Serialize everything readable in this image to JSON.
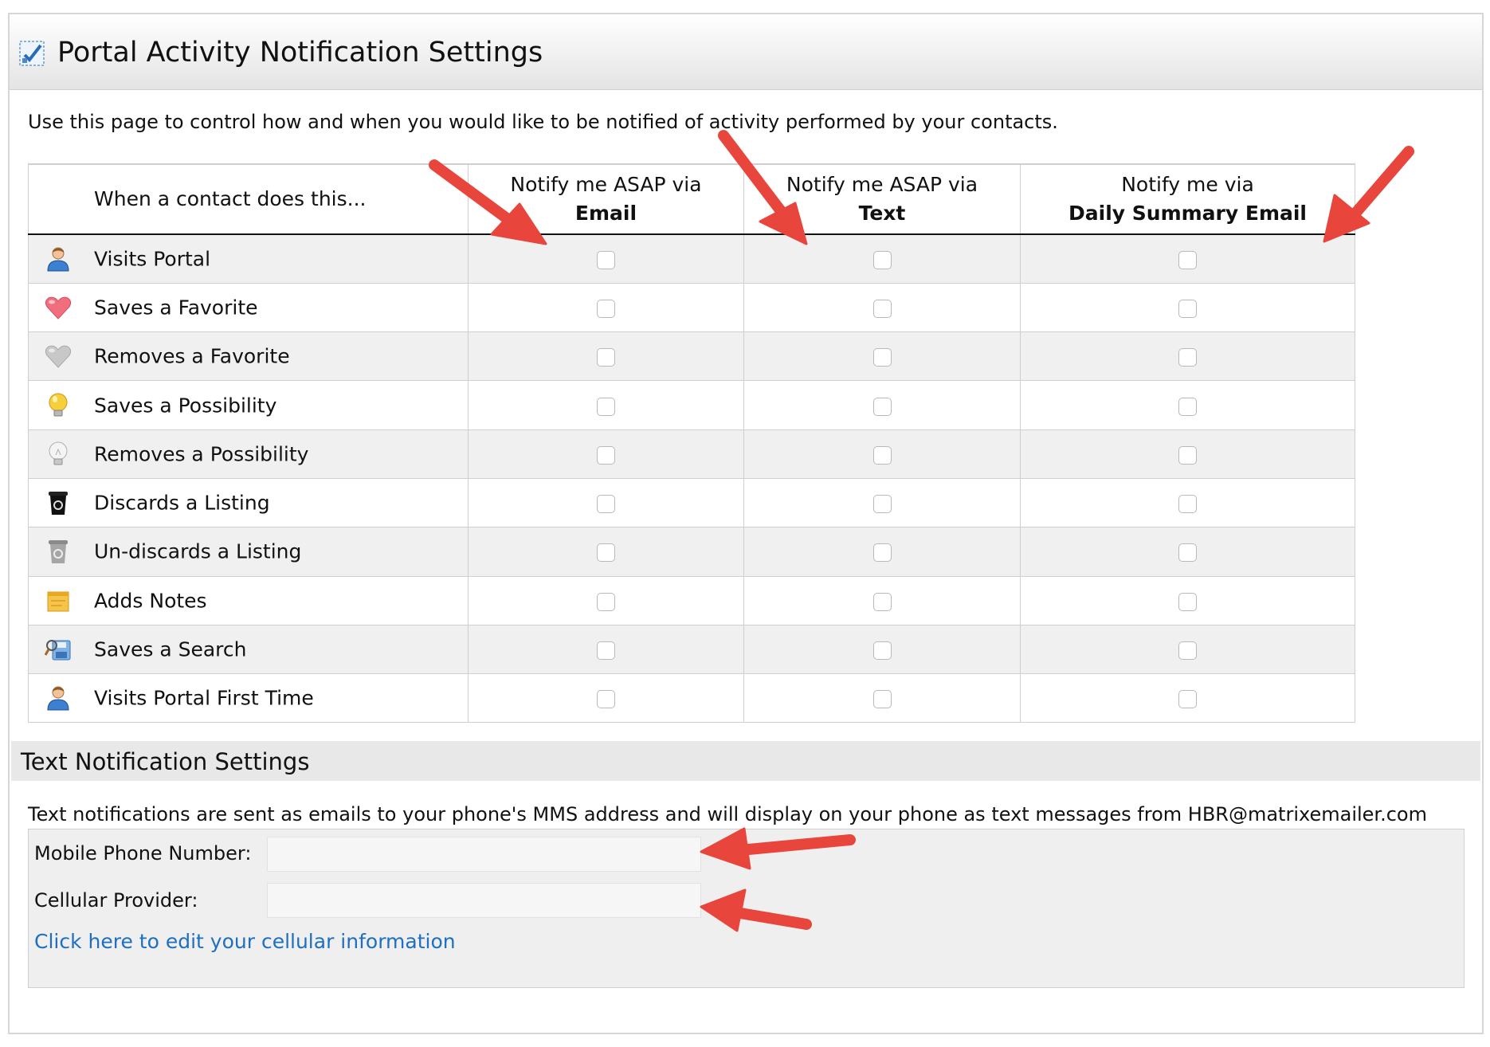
{
  "header": {
    "title": "Portal Activity Notification Settings",
    "icon": "settings-checklist-icon"
  },
  "intro": "Use this page to control how and when you would like to be notified of activity performed by your contacts.",
  "table": {
    "activity_header": "When a contact does this...",
    "columns": [
      {
        "line1": "Notify me ASAP via",
        "line2": "Email"
      },
      {
        "line1": "Notify me ASAP via",
        "line2": "Text"
      },
      {
        "line1": "Notify me via",
        "line2": "Daily Summary Email"
      }
    ],
    "rows": [
      {
        "label": "Visits Portal",
        "icon": "person-icon",
        "email": false,
        "text": false,
        "daily": false
      },
      {
        "label": "Saves a Favorite",
        "icon": "heart-red-icon",
        "email": false,
        "text": false,
        "daily": false
      },
      {
        "label": "Removes a Favorite",
        "icon": "heart-gray-icon",
        "email": false,
        "text": false,
        "daily": false
      },
      {
        "label": "Saves a Possibility",
        "icon": "lightbulb-on-icon",
        "email": false,
        "text": false,
        "daily": false
      },
      {
        "label": "Removes a Possibility",
        "icon": "lightbulb-off-icon",
        "email": false,
        "text": false,
        "daily": false
      },
      {
        "label": "Discards a Listing",
        "icon": "recycle-bin-black-icon",
        "email": false,
        "text": false,
        "daily": false
      },
      {
        "label": "Un-discards a Listing",
        "icon": "recycle-bin-gray-icon",
        "email": false,
        "text": false,
        "daily": false
      },
      {
        "label": "Adds Notes",
        "icon": "note-icon",
        "email": false,
        "text": false,
        "daily": false
      },
      {
        "label": "Saves a Search",
        "icon": "save-search-icon",
        "email": false,
        "text": false,
        "daily": false
      },
      {
        "label": "Visits Portal First Time",
        "icon": "person-icon",
        "email": false,
        "text": false,
        "daily": false
      }
    ]
  },
  "text_settings": {
    "title": "Text Notification Settings",
    "note": "Text notifications are sent as emails to your phone's MMS address and will display on your phone as text messages from HBR@matrixemailer.com",
    "mobile_label": "Mobile Phone Number:",
    "mobile_value": "",
    "provider_label": "Cellular Provider:",
    "provider_value": "",
    "edit_link": "Click here to edit your cellular information"
  },
  "colors": {
    "annotation_arrow": "#e8453c",
    "link": "#1e6fc0",
    "row_alt": "#f0f0f0"
  }
}
